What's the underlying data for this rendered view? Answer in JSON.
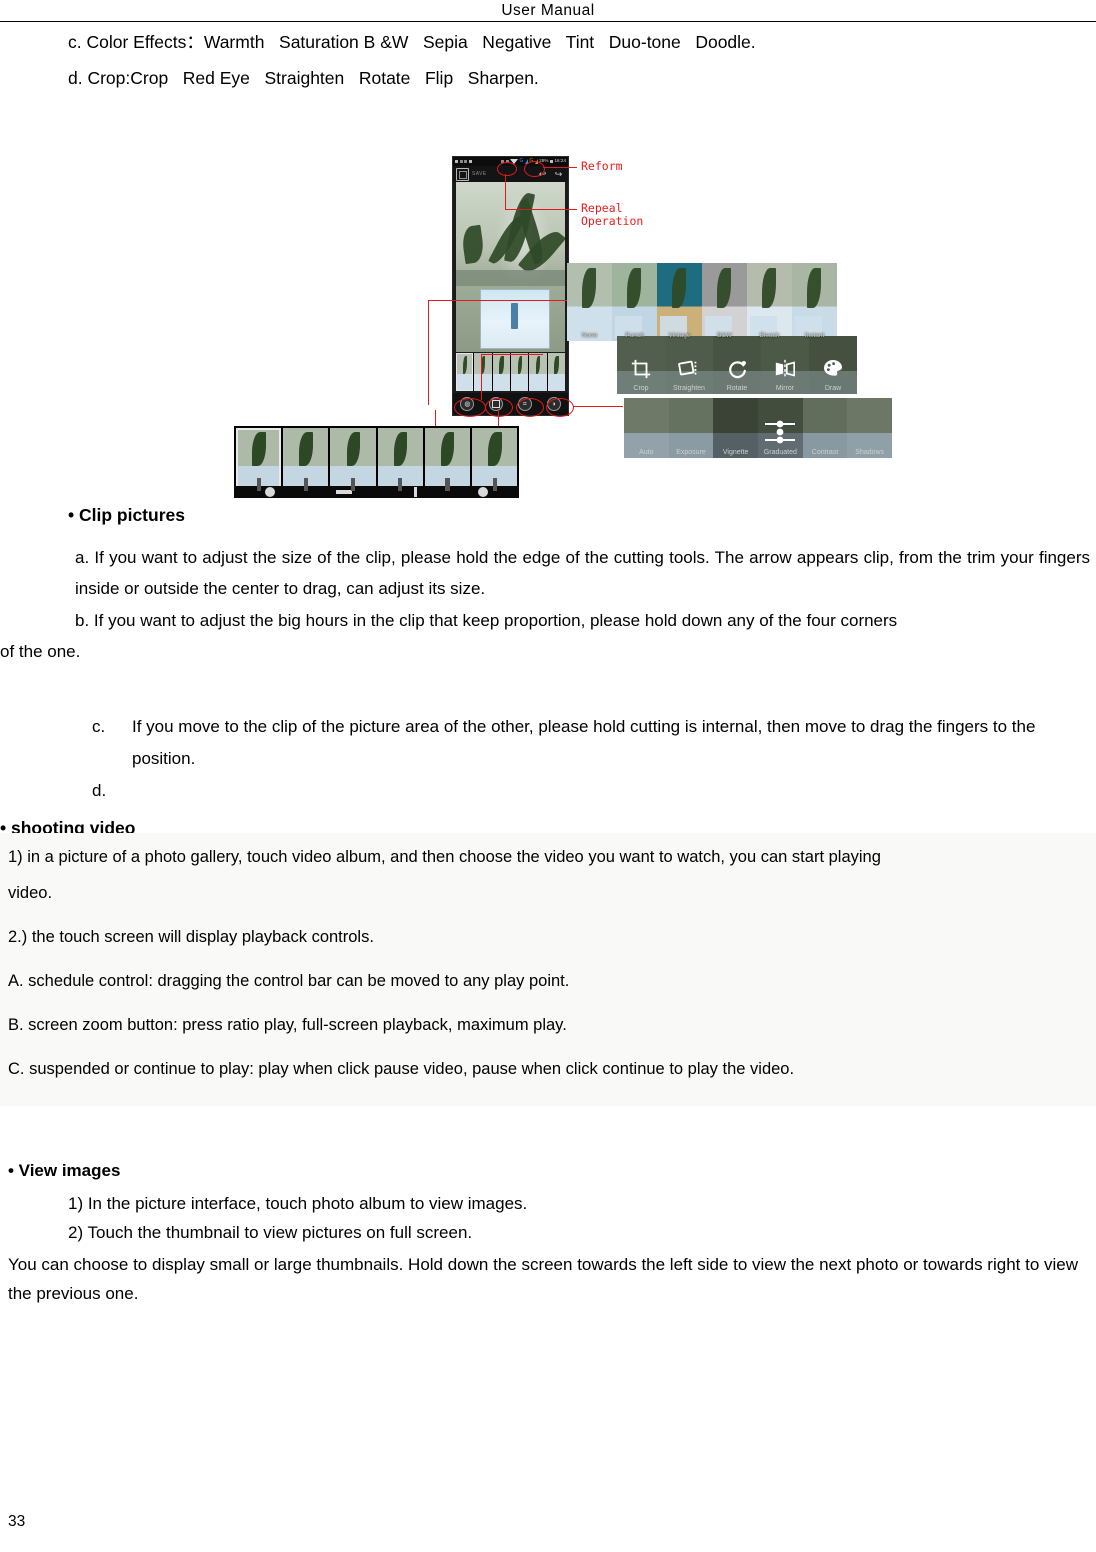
{
  "header": {
    "title": "User   Manual"
  },
  "page_number": "33",
  "top_list": {
    "item_c": "c. Color Effects：Warmth   Saturation B &W   Sepia   Negative   Tint   Duo-tone   Doodle.",
    "item_d": "d. Crop:Crop   Red Eye   Straighten   Rotate   Flip   Sharpen."
  },
  "figure": {
    "annotations": {
      "reform": "Reform",
      "repeal_operation": "Repeal\nOperation"
    },
    "phone": {
      "status_battery": "28%",
      "status_time": "16:24",
      "action_save_label": "SAVE",
      "undo_icon": "↩",
      "redo_icon": "↪"
    },
    "filter_strip": {
      "items": [
        "None",
        "Punch",
        "Vintage",
        "B&W",
        "Bleach",
        "Instant"
      ],
      "selected_index": 0
    },
    "edit_tools": {
      "items": [
        "Crop",
        "Straighten",
        "Rotate",
        "Mirror",
        "Draw"
      ]
    },
    "adjust_tools": {
      "items": [
        "Auto",
        "Exposure",
        "Vignette",
        "Graduated",
        "Contrast",
        "Shadows"
      ]
    },
    "bottom_toolbar_icons": [
      "filters-icon",
      "frames-icon",
      "crop-icon",
      "adjust-icon"
    ],
    "colors": {
      "annotation_red": "#ec1c1c",
      "phone_chrome": "#1b1b1b"
    }
  },
  "clip_pictures": {
    "heading": "• Clip pictures",
    "a": "a. If you want to adjust the size of the clip, please hold the edge of the cutting tools. The arrow appears clip, from the trim your fingers inside or outside the center to drag, can adjust its size.",
    "b_line1": "b. If you want to adjust the big hours in the clip that keep proportion, please hold down any of the four corners",
    "b_line2": "of the one.",
    "c_marker": "c.",
    "c": "If you move to the clip of the picture area of the other, please hold cutting is internal, then move to drag the fingers to the position.",
    "d_marker": "d."
  },
  "shooting_video": {
    "heading": "• shooting video",
    "lines": [
      "1) in a picture of a photo gallery, touch video album, and then choose the video you want to watch, you can start playing",
      "video.",
      "2.) the touch screen will display playback controls.",
      "A. schedule control: dragging the control bar can be moved to any play point.",
      "B. screen zoom button: press ratio play, full-screen playback, maximum play.",
      "C. suspended or continue to play: play when click pause video, pause when click continue to play the video."
    ]
  },
  "view_images": {
    "heading": "• View images",
    "item_1": "1) In the picture interface, touch photo album to view images.",
    "item_2": "2) Touch the thumbnail to view pictures on full screen.",
    "paragraph": "You can choose to display small or large thumbnails. Hold down the screen towards the left side to view the next photo or towards right to view the previous one."
  }
}
